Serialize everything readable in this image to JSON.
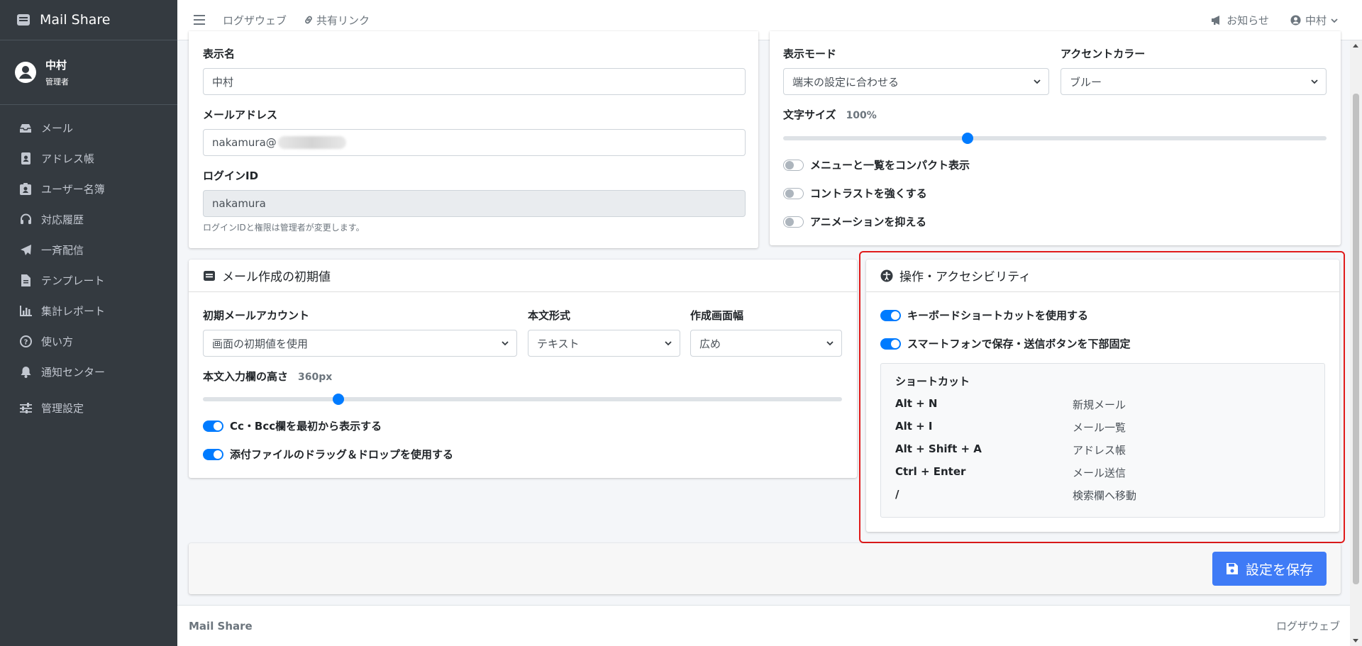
{
  "app": {
    "brand": "Mail Share"
  },
  "user": {
    "name": "中村",
    "role": "管理者"
  },
  "sidebar": {
    "items": [
      {
        "label": "メール",
        "icon": "inbox-icon"
      },
      {
        "label": "アドレス帳",
        "icon": "address-book-icon"
      },
      {
        "label": "ユーザー名簿",
        "icon": "id-badge-icon"
      },
      {
        "label": "対応履歴",
        "icon": "headset-icon"
      },
      {
        "label": "一斉配信",
        "icon": "paper-plane-icon"
      },
      {
        "label": "テンプレート",
        "icon": "file-icon"
      },
      {
        "label": "集計レポート",
        "icon": "chart-icon"
      },
      {
        "label": "使い方",
        "icon": "question-icon"
      },
      {
        "label": "通知センター",
        "icon": "bell-icon"
      },
      {
        "label": "管理設定",
        "icon": "sliders-icon"
      }
    ]
  },
  "topbar": {
    "links": [
      "ログザウェブ",
      "共有リンク"
    ],
    "notice": "お知らせ",
    "user": "中村"
  },
  "profile": {
    "display_name_label": "表示名",
    "display_name_value": "中村",
    "email_label": "メールアドレス",
    "email_value": "nakamura@",
    "login_label": "ログインID",
    "login_value": "nakamura",
    "login_help": "ログインIDと権限は管理者が変更します。"
  },
  "display": {
    "mode_label": "表示モード",
    "mode_value": "端末の設定に合わせる",
    "accent_label": "アクセントカラー",
    "accent_value": "ブルー",
    "font_size_label": "文字サイズ",
    "font_size_value": "100%",
    "font_size_level": 0.34,
    "toggles": [
      {
        "label": "メニューと一覧をコンパクト表示",
        "on": false
      },
      {
        "label": "コントラストを強くする",
        "on": false
      },
      {
        "label": "アニメーションを抑える",
        "on": false
      }
    ]
  },
  "compose": {
    "title": "メール作成の初期値",
    "account_label": "初期メールアカウント",
    "account_value": "画面の初期値を使用",
    "format_label": "本文形式",
    "format_value": "テキスト",
    "width_label": "作成画面幅",
    "width_value": "広め",
    "height_label": "本文入力欄の高さ",
    "height_value": "360px",
    "height_level": 0.212,
    "toggles": [
      {
        "label": "Cc・Bcc欄を最初から表示する",
        "on": true
      },
      {
        "label": "添付ファイルのドラッグ＆ドロップを使用する",
        "on": true
      }
    ]
  },
  "accessibility": {
    "title": "操作・アクセシビリティ",
    "toggles": [
      {
        "label": "キーボードショートカットを使用する",
        "on": true
      },
      {
        "label": "スマートフォンで保存・送信ボタンを下部固定",
        "on": true
      }
    ],
    "shortcuts_title": "ショートカット",
    "shortcuts": [
      {
        "key": "Alt + N",
        "action": "新規メール"
      },
      {
        "key": "Alt + I",
        "action": "メール一覧"
      },
      {
        "key": "Alt + Shift + A",
        "action": "アドレス帳"
      },
      {
        "key": "Ctrl + Enter",
        "action": "メール送信"
      },
      {
        "key": "/",
        "action": "検索欄へ移動"
      }
    ]
  },
  "save_label": "設定を保存",
  "footer": {
    "left": "Mail Share",
    "right": "ログザウェブ"
  },
  "colors": {
    "sidebar": "#343a40",
    "accent": "#007bff",
    "save": "#3f7bf6",
    "highlight": "#e01b1b"
  }
}
